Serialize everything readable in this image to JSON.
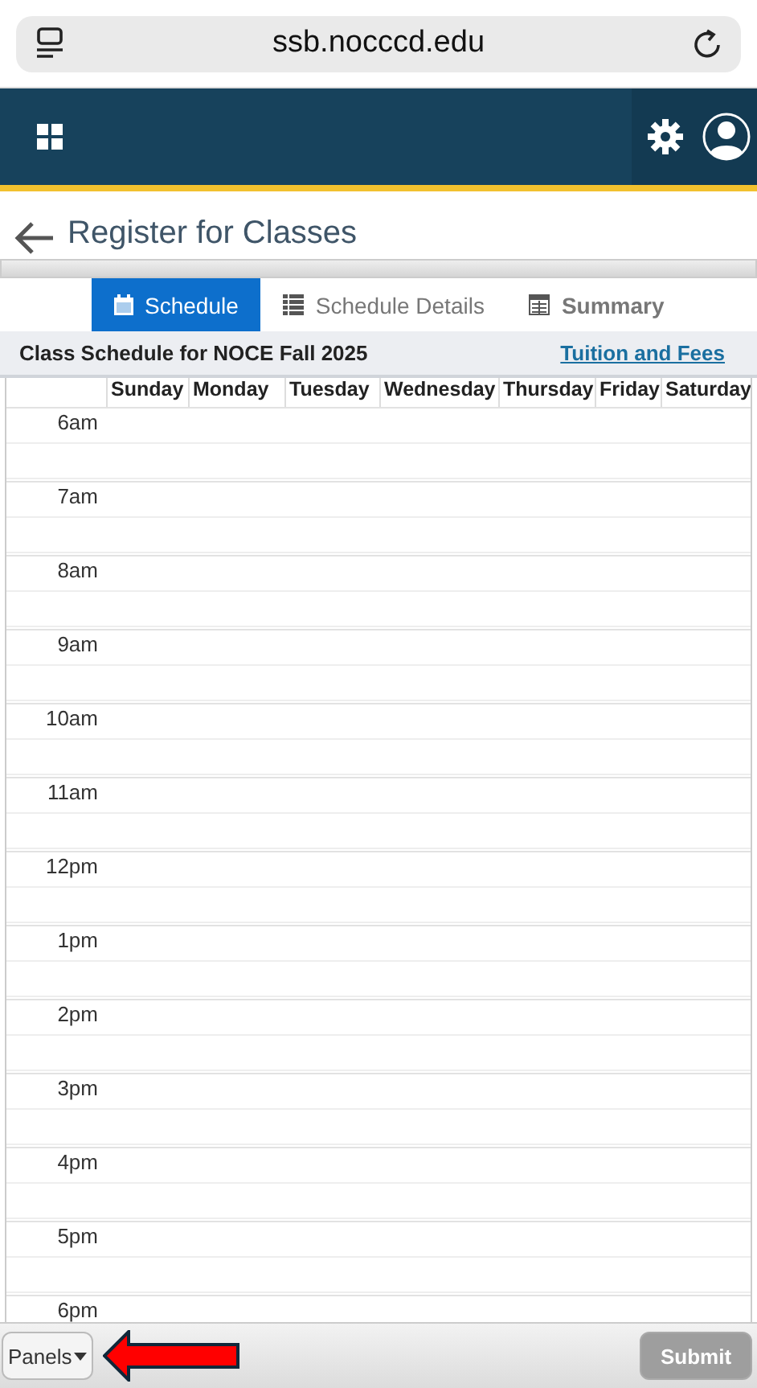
{
  "browser": {
    "url": "ssb.nocccd.edu"
  },
  "page_title": "Register for Classes",
  "tabs": [
    {
      "label": "Schedule",
      "selected": true
    },
    {
      "label": "Schedule Details",
      "selected": false
    },
    {
      "label": "Summary",
      "selected": false
    }
  ],
  "schedule": {
    "heading": "Class Schedule for NOCE Fall 2025",
    "link": "Tuition and Fees",
    "days": [
      "Sunday",
      "Monday",
      "Tuesday",
      "Wednesday",
      "Thursday",
      "Friday",
      "Saturday"
    ],
    "hours": [
      "6am",
      "7am",
      "8am",
      "9am",
      "10am",
      "11am",
      "12pm",
      "1pm",
      "2pm",
      "3pm",
      "4pm",
      "5pm",
      "6pm"
    ]
  },
  "footer": {
    "panels_button": "Panels",
    "submit_button": {
      "label": "Submit",
      "disabled": true
    }
  }
}
